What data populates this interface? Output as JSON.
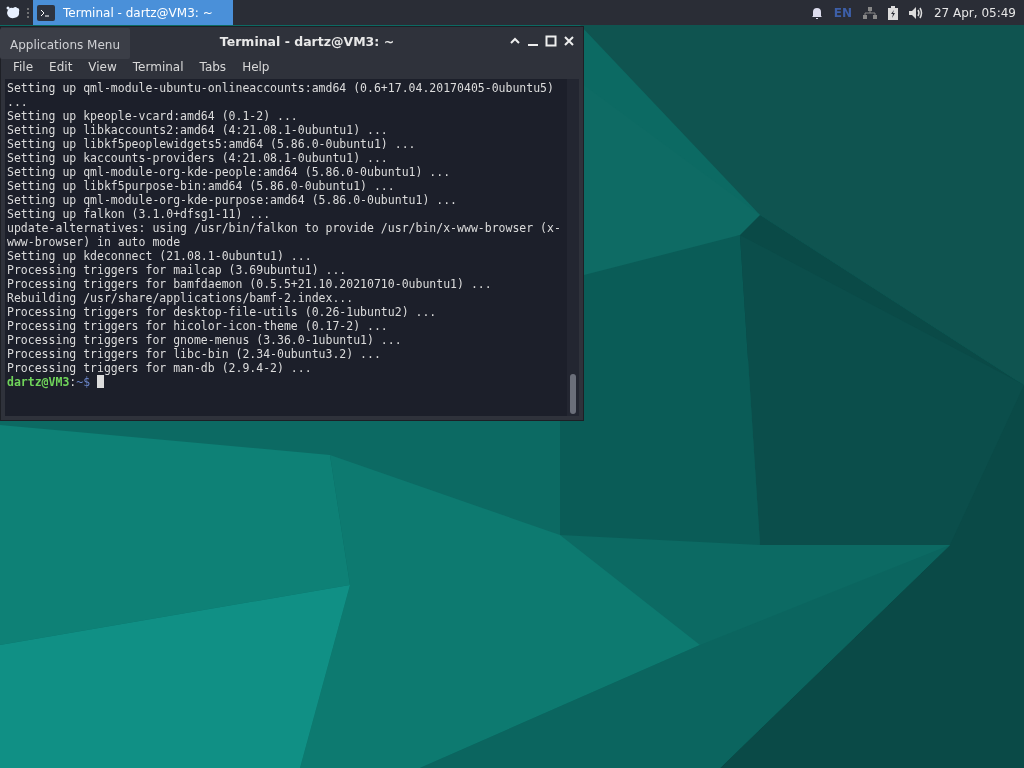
{
  "panel": {
    "taskbar": [
      {
        "title": "Terminal - dartz@VM3: ~",
        "selected": true
      }
    ],
    "keyboard_layout": "EN",
    "clock": "27 Apr, 05:49"
  },
  "tooltip": {
    "text": "Applications Menu"
  },
  "window": {
    "title": "Terminal - dartz@VM3: ~",
    "menu": [
      "File",
      "Edit",
      "View",
      "Terminal",
      "Tabs",
      "Help"
    ],
    "lines": [
      "Setting up qml-module-ubuntu-onlineaccounts:amd64 (0.6+17.04.20170405-0ubuntu5)",
      "...",
      "Setting up kpeople-vcard:amd64 (0.1-2) ...",
      "Setting up libkaccounts2:amd64 (4:21.08.1-0ubuntu1) ...",
      "Setting up libkf5peoplewidgets5:amd64 (5.86.0-0ubuntu1) ...",
      "Setting up kaccounts-providers (4:21.08.1-0ubuntu1) ...",
      "Setting up qml-module-org-kde-people:amd64 (5.86.0-0ubuntu1) ...",
      "Setting up libkf5purpose-bin:amd64 (5.86.0-0ubuntu1) ...",
      "Setting up qml-module-org-kde-purpose:amd64 (5.86.0-0ubuntu1) ...",
      "Setting up falkon (3.1.0+dfsg1-11) ...",
      "update-alternatives: using /usr/bin/falkon to provide /usr/bin/x-www-browser (x-",
      "www-browser) in auto mode",
      "Setting up kdeconnect (21.08.1-0ubuntu1) ...",
      "Processing triggers for mailcap (3.69ubuntu1) ...",
      "Processing triggers for bamfdaemon (0.5.5+21.10.20210710-0ubuntu1) ...",
      "Rebuilding /usr/share/applications/bamf-2.index...",
      "Processing triggers for desktop-file-utils (0.26-1ubuntu2) ...",
      "Processing triggers for hicolor-icon-theme (0.17-2) ...",
      "Processing triggers for gnome-menus (3.36.0-1ubuntu1) ...",
      "Processing triggers for libc-bin (2.34-0ubuntu3.2) ...",
      "Processing triggers for man-db (2.9.4-2) ..."
    ],
    "prompt": {
      "user_host": "dartz@VM3",
      "separator": ":",
      "path": "~$"
    }
  }
}
